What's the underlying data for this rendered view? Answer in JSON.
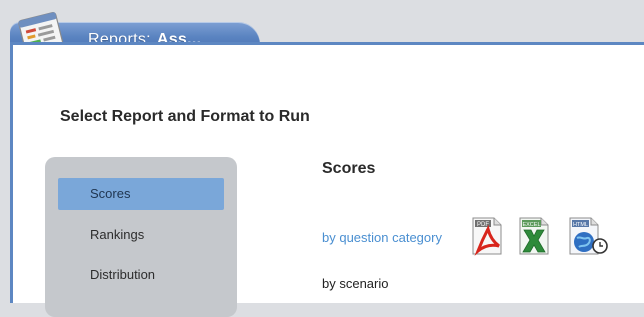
{
  "window": {
    "tab_label": "Reports:",
    "tab_object": "Ass..."
  },
  "main": {
    "heading": "Select Report and Format to Run"
  },
  "sidebar": {
    "items": [
      {
        "label": "Scores",
        "active": true
      },
      {
        "label": "Rankings",
        "active": false
      },
      {
        "label": "Distribution",
        "active": false
      }
    ]
  },
  "content": {
    "section_title": "Scores",
    "reports": [
      {
        "label": "by question category",
        "style": "link"
      },
      {
        "label": "by scenario",
        "style": "plain"
      }
    ],
    "formats": [
      {
        "icon": "pdf-icon",
        "label": "PDF"
      },
      {
        "icon": "excel-icon",
        "label": "EXCEL"
      },
      {
        "icon": "html-icon",
        "label": "HTML"
      }
    ]
  },
  "colors": {
    "accent": "#5d87c2",
    "selection": "#7aa7d9",
    "link": "#4a8fd1"
  }
}
